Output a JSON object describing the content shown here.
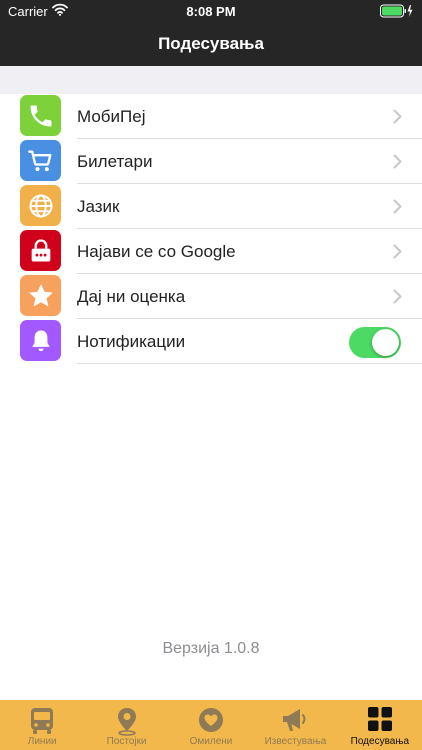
{
  "status_bar": {
    "carrier": "Carrier",
    "time": "8:08 PM"
  },
  "nav": {
    "title": "Подесувања"
  },
  "settings": {
    "items": [
      {
        "label": "МобиПеј",
        "icon": "phone-icon",
        "color": "#7dd13b",
        "control": "chevron"
      },
      {
        "label": "Билетари",
        "icon": "cart-icon",
        "color": "#4a90e2",
        "control": "chevron"
      },
      {
        "label": "Јазик",
        "icon": "globe-icon",
        "color": "#f2b04b",
        "control": "chevron"
      },
      {
        "label": "Најави се со Google",
        "icon": "lock-icon",
        "color": "#d0021b",
        "control": "chevron"
      },
      {
        "label": "Дај ни оценка",
        "icon": "star-icon",
        "color": "#f7a15e",
        "control": "chevron"
      },
      {
        "label": "Нотификации",
        "icon": "bell-icon",
        "color": "#a259ff",
        "control": "toggle",
        "toggle_on": true
      }
    ]
  },
  "version": "Верзија 1.0.8",
  "tabbar": {
    "tabs": [
      {
        "label": "Линии",
        "icon": "bus-icon",
        "active": false
      },
      {
        "label": "Постојки",
        "icon": "location-pin-icon",
        "active": false
      },
      {
        "label": "Омилени",
        "icon": "heart-icon",
        "active": false
      },
      {
        "label": "Известувања",
        "icon": "megaphone-icon",
        "active": false
      },
      {
        "label": "Подесувања",
        "icon": "grid-icon",
        "active": true
      }
    ]
  },
  "colors": {
    "nav_bg": "#262626",
    "tabbar_bg": "#f2b84b",
    "toggle_on": "#4cd964",
    "tab_inactive": "#8f7a55",
    "tab_active": "#111111"
  }
}
